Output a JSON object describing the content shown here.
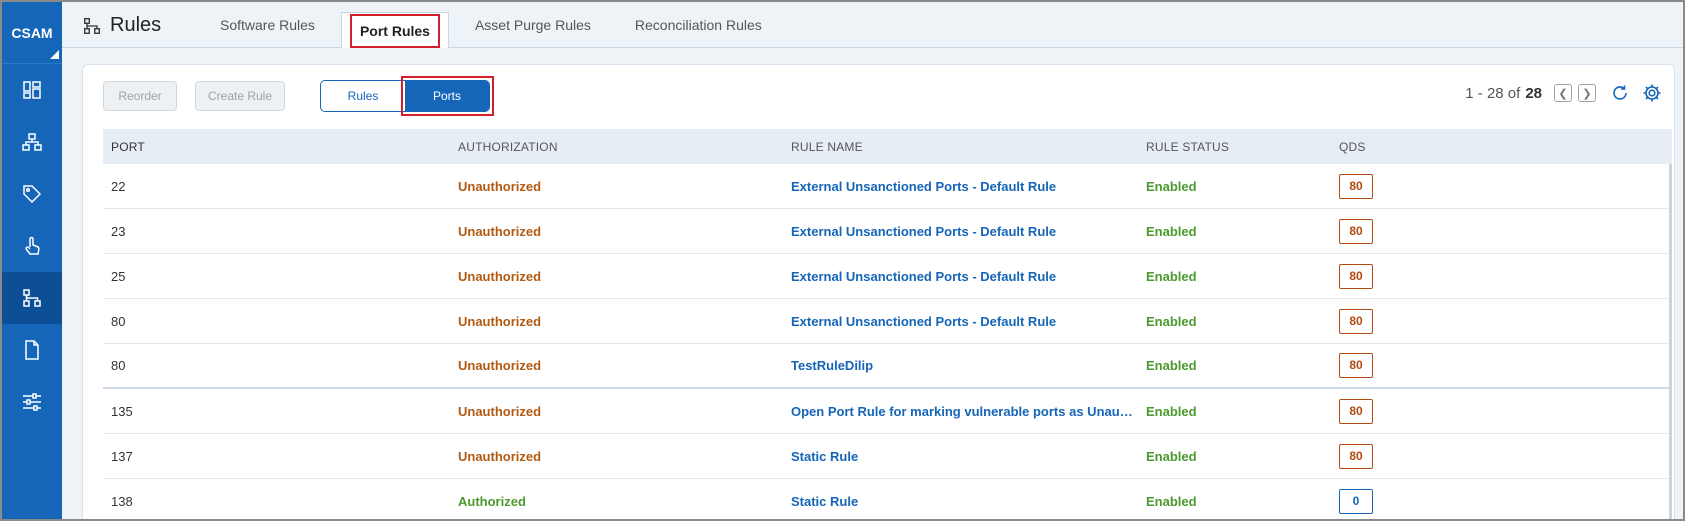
{
  "sidebar": {
    "brand": "CSAM",
    "items": [
      {
        "name": "dashboard-icon",
        "active": false
      },
      {
        "name": "inventory-icon",
        "active": false
      },
      {
        "name": "tag-icon",
        "active": false
      },
      {
        "name": "touch-icon",
        "active": false
      },
      {
        "name": "rules-icon",
        "active": true
      },
      {
        "name": "document-icon",
        "active": false
      },
      {
        "name": "sliders-icon",
        "active": false
      }
    ]
  },
  "header": {
    "title": "Rules",
    "tabs": [
      {
        "label": "Software Rules",
        "active": false
      },
      {
        "label": "Port Rules",
        "active": true
      },
      {
        "label": "Asset Purge Rules",
        "active": false
      },
      {
        "label": "Reconciliation Rules",
        "active": false
      }
    ]
  },
  "toolbar": {
    "reorder_label": "Reorder",
    "create_rule_label": "Create Rule",
    "toggle": {
      "rules_label": "Rules",
      "ports_label": "Ports",
      "selected": "Ports"
    }
  },
  "pager": {
    "range": "1 - 28 of",
    "total": "28"
  },
  "table": {
    "columns": [
      "PORT",
      "AUTHORIZATION",
      "RULE NAME",
      "RULE STATUS",
      "QDS"
    ],
    "rows": [
      {
        "port": "22",
        "authorization": "Unauthorized",
        "rule_name": "External Unsanctioned Ports - Default Rule",
        "status": "Enabled",
        "qds": "80"
      },
      {
        "port": "23",
        "authorization": "Unauthorized",
        "rule_name": "External Unsanctioned Ports - Default Rule",
        "status": "Enabled",
        "qds": "80"
      },
      {
        "port": "25",
        "authorization": "Unauthorized",
        "rule_name": "External Unsanctioned Ports - Default Rule",
        "status": "Enabled",
        "qds": "80"
      },
      {
        "port": "80",
        "authorization": "Unauthorized",
        "rule_name": "External Unsanctioned Ports - Default Rule",
        "status": "Enabled",
        "qds": "80"
      },
      {
        "port": "80",
        "authorization": "Unauthorized",
        "rule_name": "TestRuleDilip",
        "status": "Enabled",
        "qds": "80"
      },
      {
        "port": "135",
        "authorization": "Unauthorized",
        "rule_name": "Open Port Rule for marking vulnerable ports as Unauthorized",
        "status": "Enabled",
        "qds": "80"
      },
      {
        "port": "137",
        "authorization": "Unauthorized",
        "rule_name": "Static Rule",
        "status": "Enabled",
        "qds": "80"
      },
      {
        "port": "138",
        "authorization": "Authorized",
        "rule_name": "Static Rule",
        "status": "Enabled",
        "qds": "0"
      }
    ]
  },
  "colors": {
    "brand": "#1565b8",
    "unauthorized": "#b35a12",
    "authorized": "#4a9a2e",
    "enabled": "#4a9a2e",
    "qds_high": "#b34a12",
    "qds_low": "#1565b8",
    "highlight": "#d21f2a"
  }
}
